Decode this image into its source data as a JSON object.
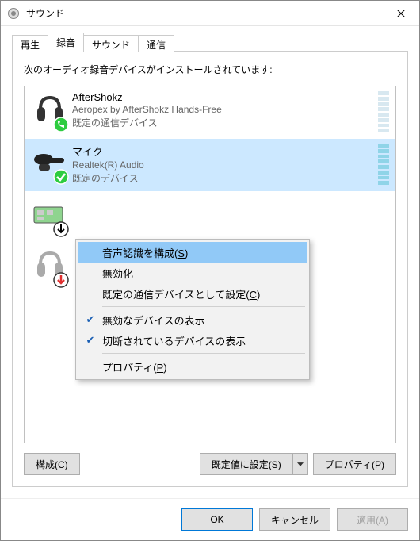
{
  "window": {
    "title": "サウンド"
  },
  "tabs": [
    {
      "label": "再生"
    },
    {
      "label": "録音",
      "active": true
    },
    {
      "label": "サウンド"
    },
    {
      "label": "通信"
    }
  ],
  "panel": {
    "description": "次のオーディオ録音デバイスがインストールされています:"
  },
  "devices": [
    {
      "name": "AfterShokz",
      "desc": "Aeropex by AfterShokz Hands-Free",
      "status": "既定の通信デバイス",
      "icon": "headset",
      "badge": "phone-green",
      "selected": false
    },
    {
      "name": "マイク",
      "desc": "Realtek(R) Audio",
      "status": "既定のデバイス",
      "icon": "mic",
      "badge": "check-green",
      "selected": true
    },
    {
      "name": "",
      "desc": "",
      "status": "",
      "icon": "card",
      "badge": "down-arrow",
      "selected": false
    },
    {
      "name": "",
      "desc": "",
      "status": "",
      "icon": "headset-grey",
      "badge": "down-arrow-red",
      "selected": false
    }
  ],
  "context_menu": {
    "items": [
      {
        "label_pre": "音声認識を構成(",
        "hotkey": "S",
        "label_post": ")",
        "highlighted": true
      },
      {
        "label_pre": "無効化",
        "hotkey": "",
        "label_post": ""
      },
      {
        "label_pre": "既定の通信デバイスとして設定(",
        "hotkey": "C",
        "label_post": ")"
      },
      {
        "sep": true
      },
      {
        "label_pre": "無効なデバイスの表示",
        "hotkey": "",
        "label_post": "",
        "checked": true
      },
      {
        "label_pre": "切断されているデバイスの表示",
        "hotkey": "",
        "label_post": "",
        "checked": true
      },
      {
        "sep": true
      },
      {
        "label_pre": "プロパティ(",
        "hotkey": "P",
        "label_post": ")"
      }
    ]
  },
  "panel_buttons": {
    "configure": "構成(C)",
    "set_default": "既定値に設定(S)",
    "properties": "プロパティ(P)"
  },
  "footer_buttons": {
    "ok": "OK",
    "cancel": "キャンセル",
    "apply": "適用(A)"
  }
}
